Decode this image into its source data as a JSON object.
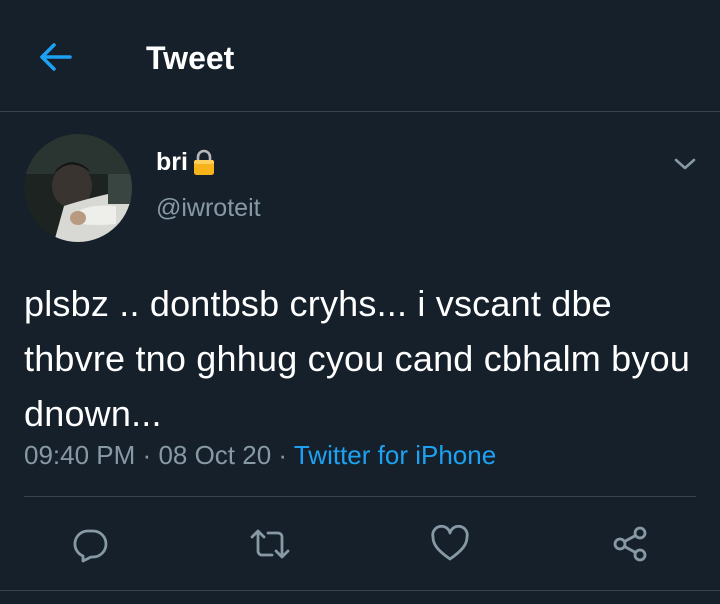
{
  "header": {
    "title": "Tweet",
    "back_icon": "arrow-left-icon"
  },
  "colors": {
    "background": "#15202b",
    "accent": "#1da1f2",
    "secondary_text": "#8899a6",
    "divider": "#38444d"
  },
  "tweet": {
    "author": {
      "display_name": "bri",
      "handle": "@iwroteit",
      "protected_icon": "lock-icon",
      "avatar_icon": "avatar-photo"
    },
    "menu_icon": "chevron-down-icon",
    "text": "plsbz .. dontbsb cryhs... i vscant dbe thbvre tno ghhug cyou cand cbhalm byou dnown...",
    "time": "09:40 PM",
    "separator": "·",
    "date": "08 Oct 20",
    "source": "Twitter for iPhone"
  },
  "actions": [
    {
      "name": "reply",
      "icon": "reply-icon"
    },
    {
      "name": "retweet",
      "icon": "retweet-icon"
    },
    {
      "name": "like",
      "icon": "heart-icon"
    },
    {
      "name": "share",
      "icon": "share-icon"
    }
  ]
}
